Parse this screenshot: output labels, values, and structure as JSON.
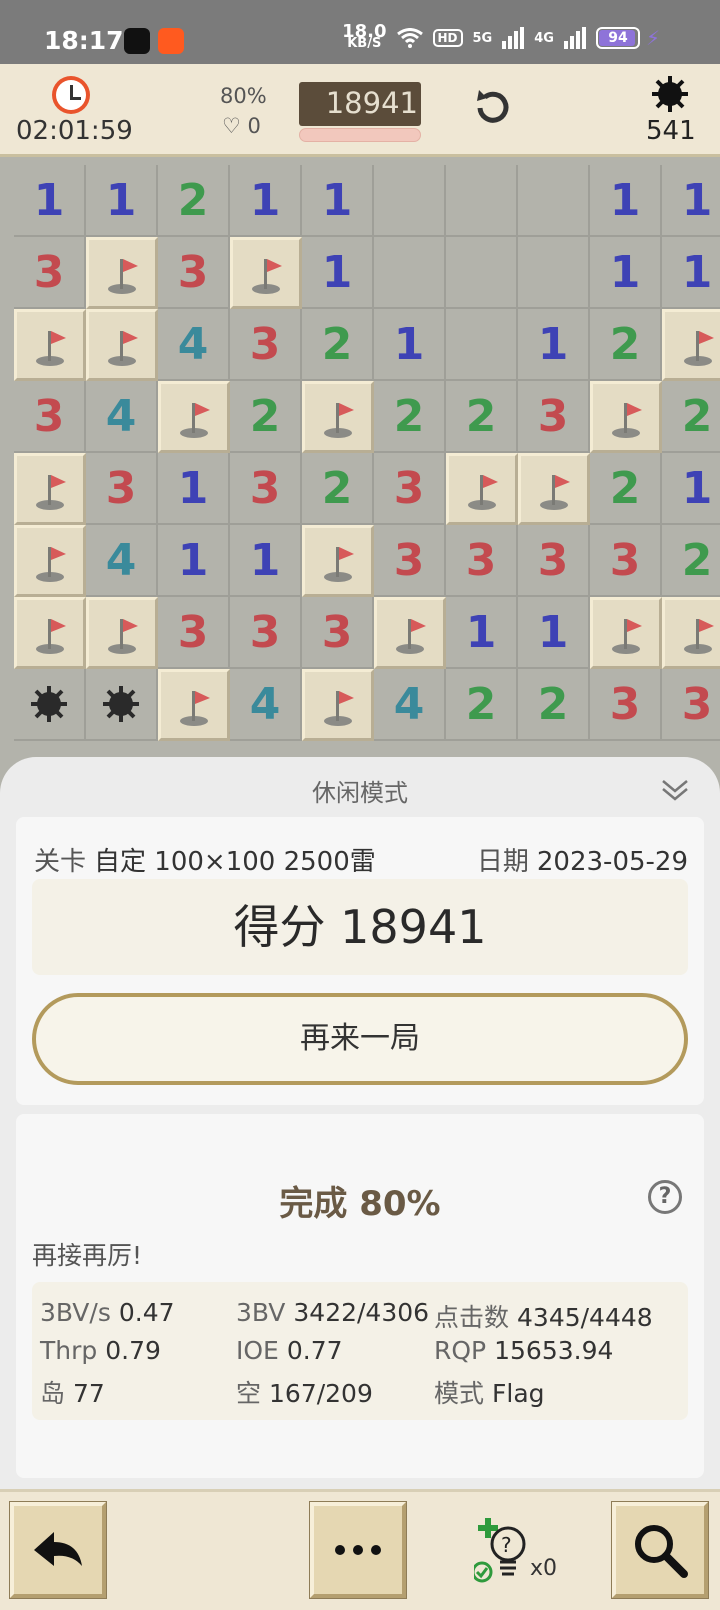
{
  "status_bar": {
    "time": "18:17",
    "net_speed": "18.0",
    "net_unit": "KB/S",
    "hd": "HD",
    "sig1": "5G",
    "sig2": "4G",
    "battery": "94"
  },
  "header": {
    "timer": "02:01:59",
    "progress": "80%",
    "lives": "0",
    "score": "18941",
    "mines_left": "541"
  },
  "board": {
    "rows": [
      [
        "1",
        "1",
        "2",
        "1",
        "1",
        "",
        "",
        "",
        "1",
        "1"
      ],
      [
        "3",
        "F",
        "3",
        "F",
        "1",
        "",
        "",
        "",
        "1",
        "1"
      ],
      [
        "F",
        "F",
        "4",
        "3",
        "2",
        "1",
        "",
        "1",
        "2",
        "F"
      ],
      [
        "3",
        "4",
        "F",
        "2",
        "F",
        "2",
        "2",
        "3",
        "F",
        "2"
      ],
      [
        "F",
        "3",
        "1",
        "3",
        "2",
        "3",
        "F",
        "F",
        "2",
        "1"
      ],
      [
        "F",
        "4",
        "1",
        "1",
        "F",
        "3",
        "3",
        "3",
        "3",
        "2"
      ],
      [
        "F",
        "F",
        "3",
        "3",
        "3",
        "F",
        "1",
        "1",
        "F",
        "F"
      ],
      [
        "M",
        "M",
        "F",
        "4",
        "F",
        "4",
        "2",
        "2",
        "3",
        "3"
      ]
    ],
    "colors": {
      "1": "#3e42b5",
      "2": "#3f9a4e",
      "3": "#c34a4f",
      "4": "#3a8a9b"
    }
  },
  "result": {
    "mode_title": "休闲模式",
    "level_label": "关卡",
    "level_value": "自定 100×100  2500雷",
    "date_label": "日期",
    "date_value": "2023-05-29",
    "score_text": "得分 18941",
    "again_label": "再来一局",
    "complete_label": "完成",
    "complete_value": "80%",
    "help": "?",
    "encourage": "再接再厉!",
    "stats": {
      "bv_s_k": "3BV/s",
      "bv_s_v": "0.47",
      "bv_k": "3BV",
      "bv_v": "3422/4306",
      "clicks_k": "点击数",
      "clicks_v": "4345/4448",
      "thrp_k": "Thrp",
      "thrp_v": "0.79",
      "ioe_k": "IOE",
      "ioe_v": "0.77",
      "rqp_k": "RQP",
      "rqp_v": "15653.94",
      "island_k": "岛",
      "island_v": "77",
      "empty_k": "空",
      "empty_v": "167/209",
      "mode_k": "模式",
      "mode_v": "Flag"
    }
  },
  "toolbar": {
    "hint_count": "x0"
  }
}
